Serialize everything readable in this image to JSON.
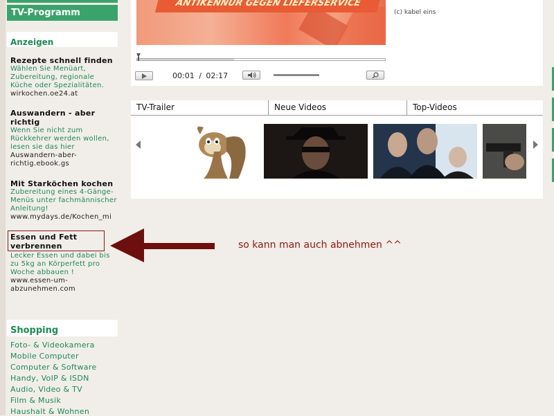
{
  "sidebar": {
    "nav_active": "TV-Programm",
    "ads_heading": "Anzeigen",
    "ads": [
      {
        "title": "Rezepte schnell finden",
        "text": "Wählen Sie Menüart, Zubereitung, regionale Küche oder Spezialitäten.",
        "url": "wirkochen.oe24.at"
      },
      {
        "title": "Auswandern - aber richtig",
        "text": "Wenn Sie nicht zum Rückkehrer werden wollen, lesen sie das hier",
        "url": "Auswandern-aber-richtig.ebook.gs"
      },
      {
        "title": "Mit Starköchen kochen",
        "text": "Zubereitung eines 4-Gänge-Menüs unter fachmännischer Anleitung!",
        "url": "www.mydays.de/Kochen_mi"
      },
      {
        "title": "Essen und Fett verbrennen",
        "text": "Lecker Essen und dabei bis zu 5kg an Körperfett pro Woche abbauen !",
        "url": "www.essen-um-abzunehmen.com"
      }
    ],
    "shop_heading": "Shopping",
    "shop_links": [
      "Foto- & Videokamera",
      "Mobile Computer",
      "Computer & Software",
      "Handy, VoIP & ISDN",
      "Audio, Video & TV",
      "Film & Musik",
      "Haushalt & Wohnen"
    ]
  },
  "player": {
    "video_banner": "ANTIKENNUR GEGEN LIEFERSERVICE",
    "copyright": "(c) kabel eins",
    "time_current": "00:01",
    "time_separator": "/",
    "time_total": "02:17",
    "progress": 0.39
  },
  "video_lists": {
    "tabs": [
      "TV-Trailer",
      "Neue Videos",
      "Top-Videos"
    ]
  },
  "annotation": "so kann man auch abnehmen ^^",
  "colors": {
    "brand_green": "#3aa36b",
    "link_green": "#1b8b54",
    "annotation_red": "#8a1a12"
  }
}
